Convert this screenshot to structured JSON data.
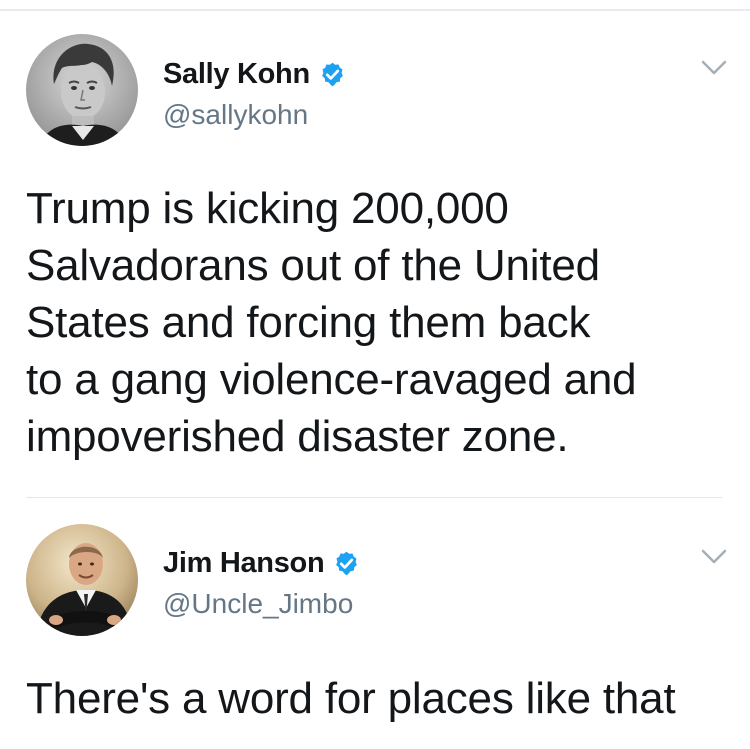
{
  "tweets": [
    {
      "author_name": "Sally Kohn",
      "handle": "@sallykohn",
      "verified": true,
      "avatar_icon": "avatar-photo-icon",
      "text": "Trump is kicking 200,000\nSalvadorans out of the United\nStates and forcing them back\nto a gang violence-ravaged and\nimpoverished disaster zone."
    },
    {
      "author_name": "Jim Hanson",
      "handle": "@Uncle_Jimbo",
      "verified": true,
      "avatar_icon": "avatar-photo-icon",
      "text": "There's a word for places like that"
    }
  ],
  "icons": {
    "verified": "verified-badge-icon",
    "more": "chevron-down-icon"
  },
  "colors": {
    "verified_blue": "#1da1f2",
    "text_primary": "#14171a",
    "text_secondary": "#657786",
    "divider": "#e1e8ed"
  }
}
